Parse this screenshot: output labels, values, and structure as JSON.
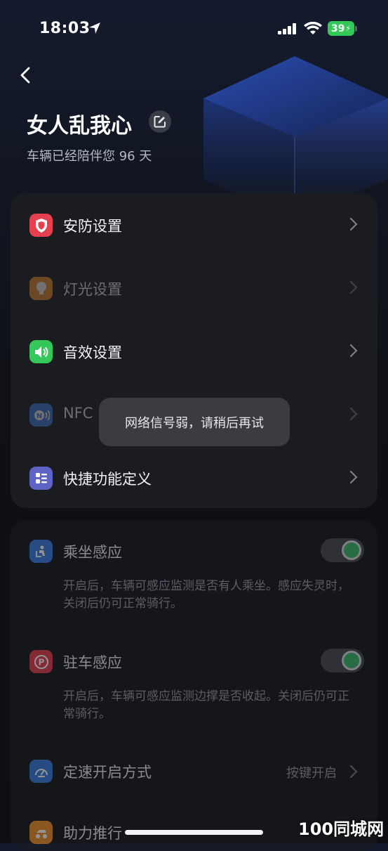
{
  "status_bar": {
    "time": "18:03",
    "battery": "39"
  },
  "header": {
    "title": "女人乱我心",
    "subtitle": "车辆已经陪伴您 96 天"
  },
  "menu": {
    "items": [
      {
        "label": "安防设置",
        "icon": "shield-icon",
        "color": "#e5404f",
        "enabled": true
      },
      {
        "label": "灯光设置",
        "icon": "bulb-icon",
        "color": "#f0932b",
        "enabled": false
      },
      {
        "label": "音效设置",
        "icon": "speaker-icon",
        "color": "#34c759",
        "enabled": true
      },
      {
        "label": "NFC",
        "icon": "nfc-icon",
        "color": "#3b7ddd",
        "enabled": false
      },
      {
        "label": "快捷功能定义",
        "icon": "shortcut-grid-icon",
        "color": "#5e63c6",
        "enabled": true
      }
    ]
  },
  "toast": {
    "message": "网络信号弱，请稍后再试"
  },
  "settings": {
    "ride_sensing": {
      "label": "乘坐感应",
      "desc": "开启后，车辆可感应监测是否有人乘坐。感应失灵时，关闭后仍可正常骑行。",
      "on": true
    },
    "parking_sensing": {
      "label": "驻车感应",
      "desc": "开启后，车辆可感应监测边撑是否收起。关闭后仍可正常骑行。",
      "on": true
    },
    "cruise": {
      "label": "定速开启方式",
      "value": "按键开启"
    },
    "push_assist": {
      "label": "助力推行"
    }
  },
  "watermark": "100同城网"
}
